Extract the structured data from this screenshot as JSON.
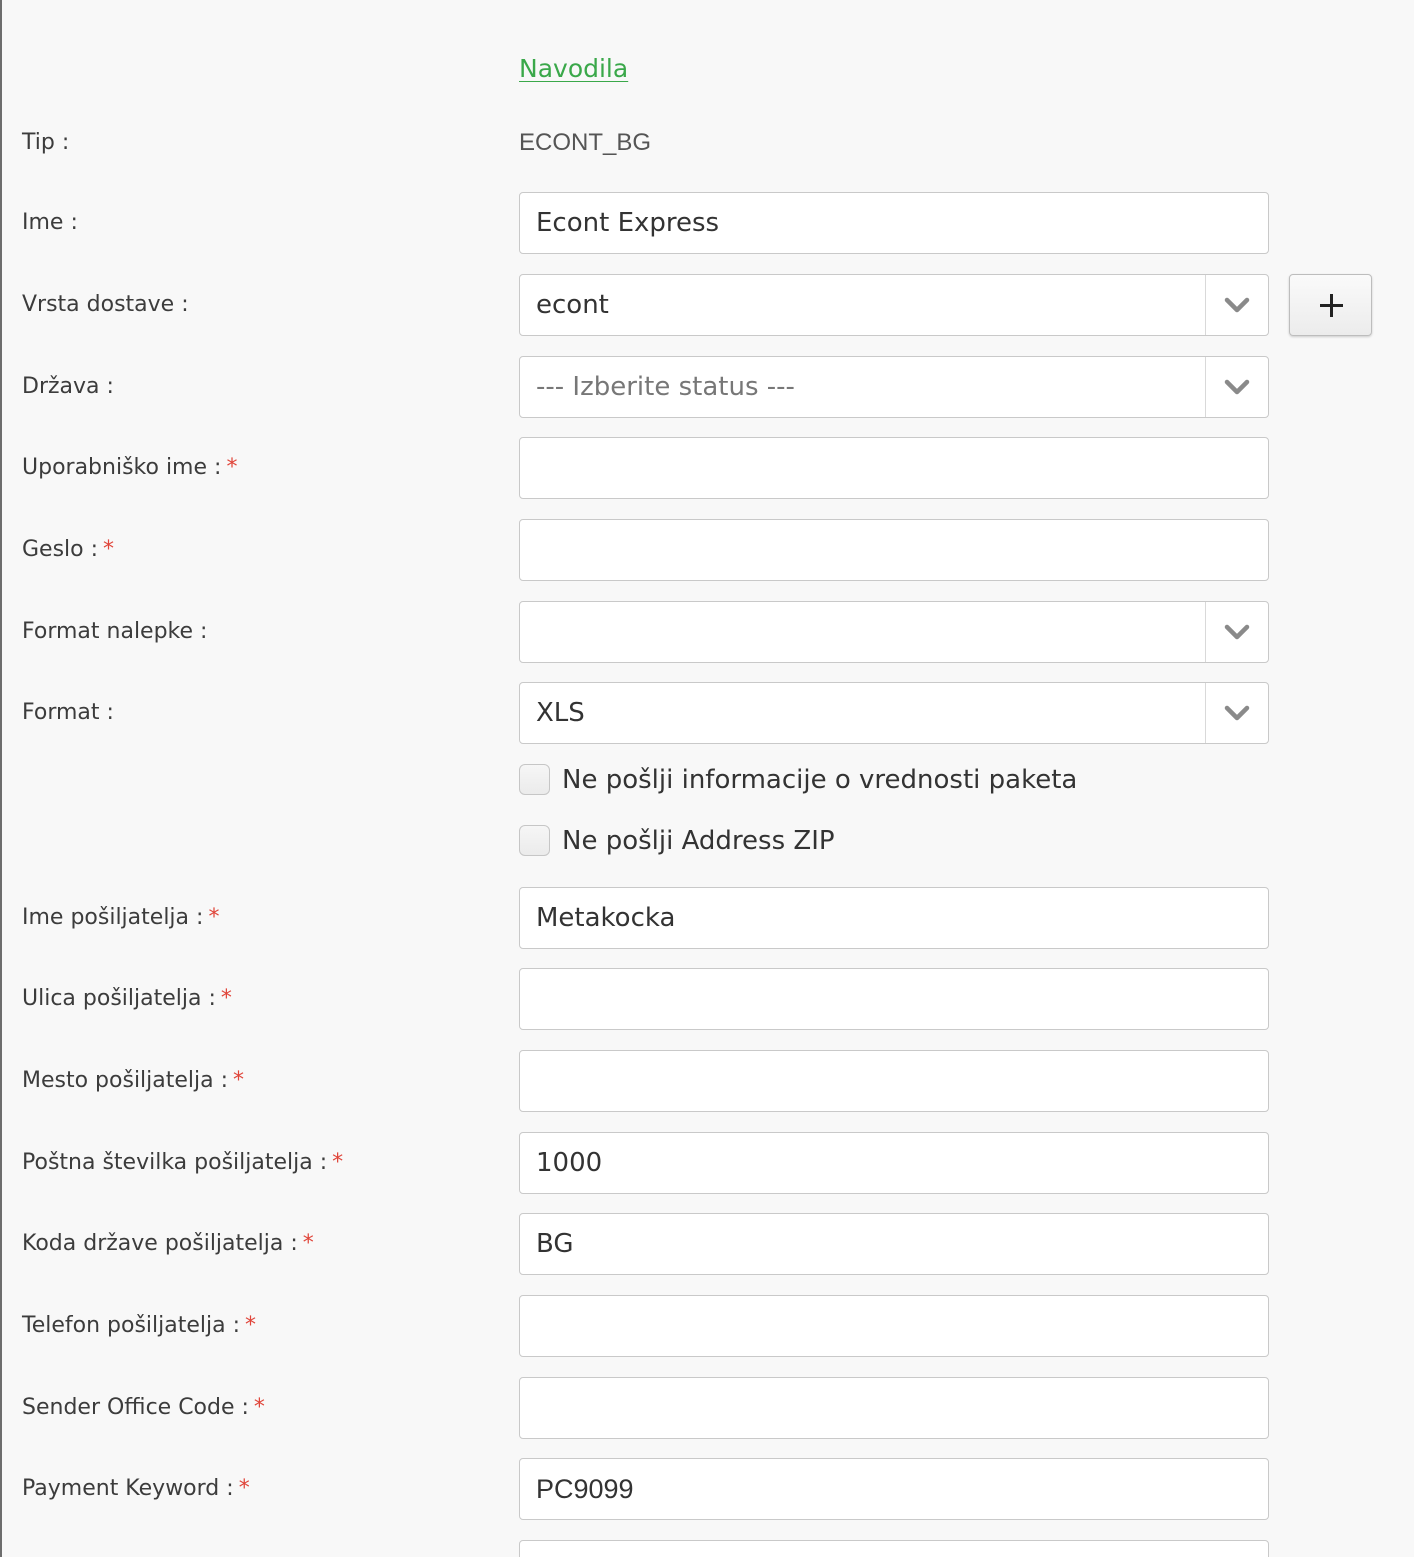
{
  "instructions_link": "Navodila",
  "type_row": {
    "label": "Tip :",
    "value": "ECONT_BG"
  },
  "fields": {
    "name": {
      "label": "Ime :",
      "value": "Econt Express"
    },
    "delivery_type": {
      "label": "Vrsta dostave :",
      "selected": "econt",
      "add_button": "+"
    },
    "country": {
      "label": "Država :",
      "selected": "--- Izberite status ---"
    },
    "username": {
      "label": "Uporabniško ime :",
      "required_mark": "*",
      "value": ""
    },
    "password": {
      "label": "Geslo :",
      "required_mark": "*",
      "value": ""
    },
    "label_format": {
      "label": "Format nalepke :",
      "selected": ""
    },
    "format": {
      "label": "Format :",
      "selected": "XLS"
    },
    "sender_name": {
      "label": "Ime pošiljatelja :",
      "required_mark": "*",
      "value": "Metakocka"
    },
    "sender_street": {
      "label": "Ulica pošiljatelja :",
      "required_mark": "*",
      "value": ""
    },
    "sender_city": {
      "label": "Mesto pošiljatelja :",
      "required_mark": "*",
      "value": ""
    },
    "sender_postal_code": {
      "label": "Poštna številka pošiljatelja :",
      "required_mark": "*",
      "value": "1000"
    },
    "sender_country_code": {
      "label": "Koda države pošiljatelja :",
      "required_mark": "*",
      "value": "BG"
    },
    "sender_phone": {
      "label": "Telefon pošiljatelja :",
      "required_mark": "*",
      "value": ""
    },
    "sender_office_code": {
      "label": "Sender Office Code :",
      "required_mark": "*",
      "value": ""
    },
    "payment_keyword": {
      "label": "Payment Keyword :",
      "required_mark": "*",
      "value": "PC9099"
    }
  },
  "checkboxes": {
    "no_package_value": {
      "label": "Ne pošlji informacije o vrednosti paketa",
      "checked": false
    },
    "no_address_zip": {
      "label": "Ne pošlji Address ZIP",
      "checked": false
    }
  },
  "icons": {
    "select_arrow": "chevron-down-icon",
    "add": "plus-icon"
  },
  "colors": {
    "link": "#3aa84a",
    "required": "#e0453a",
    "background": "#f8f8f8"
  }
}
